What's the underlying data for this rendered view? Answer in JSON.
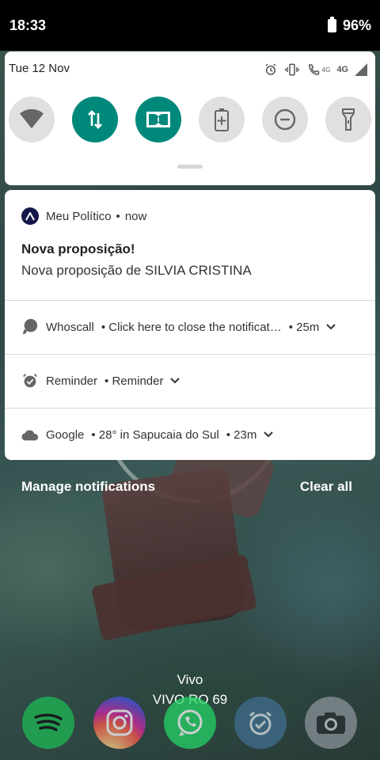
{
  "status_bar": {
    "time": "18:33",
    "battery": "96%"
  },
  "quick_settings": {
    "date": "Tue 12 Nov",
    "network_4g_small": "4G",
    "network_4g": "4G",
    "tiles": [
      {
        "icon": "wifi-icon",
        "state": "off"
      },
      {
        "icon": "mobile-data-icon",
        "state": "on"
      },
      {
        "icon": "dolby-icon",
        "state": "on"
      },
      {
        "icon": "battery-saver-icon",
        "state": "off"
      },
      {
        "icon": "do-not-disturb-icon",
        "state": "off"
      },
      {
        "icon": "flashlight-icon",
        "state": "off"
      }
    ]
  },
  "notifications": {
    "main": {
      "app": "Meu Político",
      "separator": "•",
      "time": "now",
      "title": "Nova proposição!",
      "text": "Nova proposição de SILVIA CRISTINA"
    },
    "rows": [
      {
        "app": "Whoscall",
        "text": "• Click here to close the notificat…",
        "time": "• 25m"
      },
      {
        "app": "Reminder",
        "text": "• Reminder",
        "time": ""
      },
      {
        "app": "Google",
        "text": "• 28° in Sapucaia do Sul",
        "time": "• 23m"
      }
    ]
  },
  "actions": {
    "manage": "Manage notifications",
    "clear": "Clear all"
  },
  "carrier": {
    "line1": "Vivo",
    "line2": "VIVO RO 69"
  },
  "colors": {
    "accent": "#00897b",
    "status_bar": "#000000",
    "app_logo": "#14174a"
  },
  "dock": [
    "spotify-icon",
    "instagram-icon",
    "whatsapp-icon",
    "clock-icon",
    "camera-icon"
  ]
}
